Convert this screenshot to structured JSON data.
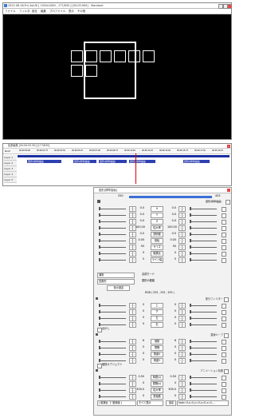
{
  "editor": {
    "title": "2022.08.19(Fri) AviUtl [ 1920x1080 , 177/630 ] [00:05:900] - Standard",
    "menu": [
      "ファイル",
      "フィルタ",
      "設定",
      "編集",
      "プロファイル",
      "表示",
      "その他"
    ]
  },
  "timeline": {
    "title": "拡張編集 [00:00:05.90] [177/630]",
    "root_label": "Root",
    "layers": [
      "Layer 1",
      "Layer 2",
      "Layer 3",
      "Layer 4",
      "Layer 5"
    ],
    "clip_label": "図形(標準描画)",
    "time_marks": [
      "00:00:00.00",
      "00:00:01.75",
      "00:00:03.50",
      "00:00:05.25",
      "00:00:07.00",
      "00:00:08.75",
      "00:00:10.50",
      "00:00:12.25",
      "00:00:14.00",
      "00:00:15.75",
      "00:00:17.50",
      "00:00:19.25"
    ]
  },
  "point_label": "ポイント",
  "panel": {
    "title": "図形[標準描画]",
    "frame_start": "250",
    "frame_end": "433",
    "top_check_label": "図形(標準描画)",
    "rows1": [
      {
        "left": "0.0",
        "label": "X",
        "right": "0.0"
      },
      {
        "left": "0.0",
        "label": "Y",
        "right": "0.0"
      },
      {
        "left": "0.0",
        "label": "Z",
        "right": "0.0"
      },
      {
        "left": "100.00",
        "label": "拡大率",
        "right": "100.00"
      },
      {
        "left": "0.0",
        "label": "透明度",
        "right": "0.0"
      },
      {
        "left": "0.00",
        "label": "回転",
        "right": "0.00"
      },
      {
        "left": "50",
        "label": "サイズ",
        "right": "50"
      },
      {
        "left": "0",
        "label": "縦横比",
        "right": "0"
      },
      {
        "left": "5",
        "label": "ライン幅",
        "right": "5"
      }
    ],
    "blend_mode": "通常",
    "blend_label": "合成モード",
    "shape_type": "四角形",
    "shape_label": "図形の種類",
    "color_button": "色の設定",
    "rgb": "RGB ( 255 , 255 , 255 )",
    "section2": {
      "title": "部分フィルター",
      "rows": [
        {
          "left": "0",
          "label": "上",
          "right": "0"
        },
        {
          "left": "0",
          "label": "下",
          "right": "0"
        },
        {
          "left": "0",
          "label": "左",
          "right": "0"
        },
        {
          "left": "0",
          "label": "右",
          "right": "0"
        }
      ]
    },
    "blur_check": "ぼかし",
    "section3": {
      "title": "直線ループ",
      "rows": [
        {
          "left": "6",
          "label": "個数",
          "right": "6"
        },
        {
          "left": "0",
          "label": "間隔",
          "right": "0"
        },
        {
          "left": "0",
          "label": "角度X",
          "right": "0"
        },
        {
          "left": "0",
          "label": "角度Y",
          "right": "0"
        }
      ]
    },
    "single_object_check": "個別オブジェクト",
    "section4": {
      "title": "アニメーション効果",
      "rows": [
        {
          "left": "0.50",
          "label": "時間(s)",
          "right": "0.50"
        },
        {
          "left": "0",
          "label": "間隔(s)",
          "right": "0"
        },
        {
          "left": "300.0",
          "label": "拡大率",
          "right": "300.0"
        },
        {
          "left": "0",
          "label": "重複数",
          "right": "0"
        }
      ]
    },
    "bottom": {
      "option1": "[ 縦横比 で 登録値 ]",
      "option2": "すべて表示",
      "setting": "設定",
      "params": "fade=0,s=0,y=0,x=0,z=0,..."
    }
  }
}
